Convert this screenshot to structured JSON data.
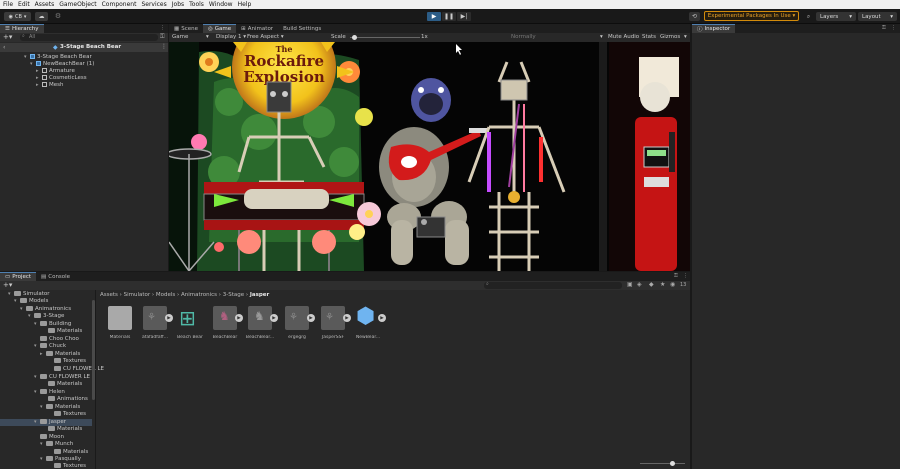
{
  "menu": [
    "File",
    "Edit",
    "Assets",
    "GameObject",
    "Component",
    "Services",
    "Jobs",
    "Tools",
    "Window",
    "Help"
  ],
  "toolbar": {
    "account": "CB",
    "experimental": "Experimental Packages In Use ▾",
    "layers": "Layers",
    "layout": "Layout"
  },
  "hierarchy": {
    "tab": "Hierarchy",
    "search_placeholder": "All",
    "scene": "3-Stage Beach Bear",
    "items": [
      {
        "label": "3-Stage Beach Bear"
      },
      {
        "label": "NewBeachBear (1)"
      },
      {
        "label": "Armature"
      },
      {
        "label": "CosmeticLess"
      },
      {
        "label": "Mesh"
      }
    ]
  },
  "game_view": {
    "tabs": [
      "Scene",
      "Game",
      "Animator",
      "Build Settings"
    ],
    "mode": "Game",
    "display": "Display 1",
    "aspect": "Free Aspect",
    "scale_label": "Scale",
    "scale_value": 0.05,
    "scale_text": "1x",
    "play_focused": "Normally",
    "options": [
      "Mute Audio",
      "Stats",
      "Gizmos"
    ],
    "sign_line1": "The",
    "sign_line2": "Rockafire",
    "sign_line3": "Explosion"
  },
  "inspector": {
    "tab": "Inspector"
  },
  "project": {
    "tabs": [
      "Project",
      "Console"
    ],
    "search_placeholder": "",
    "count_badge": "13",
    "breadcrumb": [
      "Assets",
      "Simulator",
      "Models",
      "Animatronics",
      "3-Stage",
      "Jasper"
    ],
    "tree": [
      "Simulator",
      "Models",
      "Animatronics",
      "3-Stage",
      "Building",
      "Materials",
      "Choo Choo",
      "Chuck",
      "Materials",
      "Textures",
      "CU FLOWER LE",
      "Materials",
      "Helen",
      "Animations",
      "Materials",
      "Textures",
      "Jasper",
      "Materials",
      "Moon",
      "Munch",
      "Materials",
      "Pasqually",
      "Textures"
    ],
    "assets": [
      "Materials",
      "afafadfaff...",
      "Beach Bear",
      "BeachBear",
      "BeachBear...",
      "ergegrg",
      "JasperSSF",
      "NewBear..."
    ]
  },
  "colors": {
    "accent": "#2c5d87",
    "warning": "#d38b0b",
    "sign_yellow": "#f2c21b"
  }
}
